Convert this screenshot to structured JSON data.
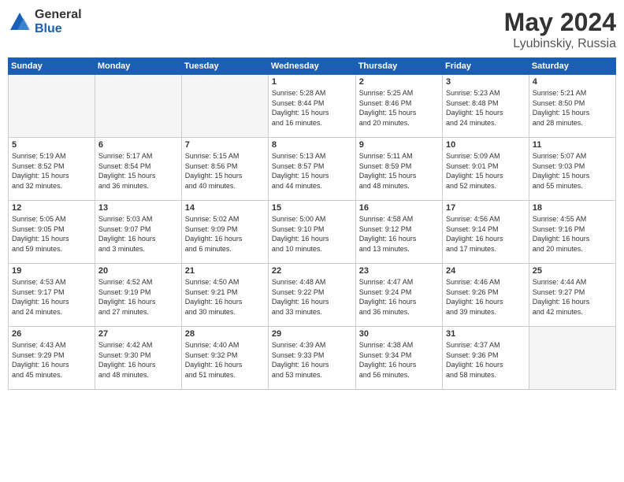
{
  "logo": {
    "general": "General",
    "blue": "Blue"
  },
  "title": {
    "month_year": "May 2024",
    "location": "Lyubinskiy, Russia"
  },
  "weekdays": [
    "Sunday",
    "Monday",
    "Tuesday",
    "Wednesday",
    "Thursday",
    "Friday",
    "Saturday"
  ],
  "weeks": [
    [
      {
        "day": "",
        "info": ""
      },
      {
        "day": "",
        "info": ""
      },
      {
        "day": "",
        "info": ""
      },
      {
        "day": "1",
        "info": "Sunrise: 5:28 AM\nSunset: 8:44 PM\nDaylight: 15 hours\nand 16 minutes."
      },
      {
        "day": "2",
        "info": "Sunrise: 5:25 AM\nSunset: 8:46 PM\nDaylight: 15 hours\nand 20 minutes."
      },
      {
        "day": "3",
        "info": "Sunrise: 5:23 AM\nSunset: 8:48 PM\nDaylight: 15 hours\nand 24 minutes."
      },
      {
        "day": "4",
        "info": "Sunrise: 5:21 AM\nSunset: 8:50 PM\nDaylight: 15 hours\nand 28 minutes."
      }
    ],
    [
      {
        "day": "5",
        "info": "Sunrise: 5:19 AM\nSunset: 8:52 PM\nDaylight: 15 hours\nand 32 minutes."
      },
      {
        "day": "6",
        "info": "Sunrise: 5:17 AM\nSunset: 8:54 PM\nDaylight: 15 hours\nand 36 minutes."
      },
      {
        "day": "7",
        "info": "Sunrise: 5:15 AM\nSunset: 8:56 PM\nDaylight: 15 hours\nand 40 minutes."
      },
      {
        "day": "8",
        "info": "Sunrise: 5:13 AM\nSunset: 8:57 PM\nDaylight: 15 hours\nand 44 minutes."
      },
      {
        "day": "9",
        "info": "Sunrise: 5:11 AM\nSunset: 8:59 PM\nDaylight: 15 hours\nand 48 minutes."
      },
      {
        "day": "10",
        "info": "Sunrise: 5:09 AM\nSunset: 9:01 PM\nDaylight: 15 hours\nand 52 minutes."
      },
      {
        "day": "11",
        "info": "Sunrise: 5:07 AM\nSunset: 9:03 PM\nDaylight: 15 hours\nand 55 minutes."
      }
    ],
    [
      {
        "day": "12",
        "info": "Sunrise: 5:05 AM\nSunset: 9:05 PM\nDaylight: 15 hours\nand 59 minutes."
      },
      {
        "day": "13",
        "info": "Sunrise: 5:03 AM\nSunset: 9:07 PM\nDaylight: 16 hours\nand 3 minutes."
      },
      {
        "day": "14",
        "info": "Sunrise: 5:02 AM\nSunset: 9:09 PM\nDaylight: 16 hours\nand 6 minutes."
      },
      {
        "day": "15",
        "info": "Sunrise: 5:00 AM\nSunset: 9:10 PM\nDaylight: 16 hours\nand 10 minutes."
      },
      {
        "day": "16",
        "info": "Sunrise: 4:58 AM\nSunset: 9:12 PM\nDaylight: 16 hours\nand 13 minutes."
      },
      {
        "day": "17",
        "info": "Sunrise: 4:56 AM\nSunset: 9:14 PM\nDaylight: 16 hours\nand 17 minutes."
      },
      {
        "day": "18",
        "info": "Sunrise: 4:55 AM\nSunset: 9:16 PM\nDaylight: 16 hours\nand 20 minutes."
      }
    ],
    [
      {
        "day": "19",
        "info": "Sunrise: 4:53 AM\nSunset: 9:17 PM\nDaylight: 16 hours\nand 24 minutes."
      },
      {
        "day": "20",
        "info": "Sunrise: 4:52 AM\nSunset: 9:19 PM\nDaylight: 16 hours\nand 27 minutes."
      },
      {
        "day": "21",
        "info": "Sunrise: 4:50 AM\nSunset: 9:21 PM\nDaylight: 16 hours\nand 30 minutes."
      },
      {
        "day": "22",
        "info": "Sunrise: 4:48 AM\nSunset: 9:22 PM\nDaylight: 16 hours\nand 33 minutes."
      },
      {
        "day": "23",
        "info": "Sunrise: 4:47 AM\nSunset: 9:24 PM\nDaylight: 16 hours\nand 36 minutes."
      },
      {
        "day": "24",
        "info": "Sunrise: 4:46 AM\nSunset: 9:26 PM\nDaylight: 16 hours\nand 39 minutes."
      },
      {
        "day": "25",
        "info": "Sunrise: 4:44 AM\nSunset: 9:27 PM\nDaylight: 16 hours\nand 42 minutes."
      }
    ],
    [
      {
        "day": "26",
        "info": "Sunrise: 4:43 AM\nSunset: 9:29 PM\nDaylight: 16 hours\nand 45 minutes."
      },
      {
        "day": "27",
        "info": "Sunrise: 4:42 AM\nSunset: 9:30 PM\nDaylight: 16 hours\nand 48 minutes."
      },
      {
        "day": "28",
        "info": "Sunrise: 4:40 AM\nSunset: 9:32 PM\nDaylight: 16 hours\nand 51 minutes."
      },
      {
        "day": "29",
        "info": "Sunrise: 4:39 AM\nSunset: 9:33 PM\nDaylight: 16 hours\nand 53 minutes."
      },
      {
        "day": "30",
        "info": "Sunrise: 4:38 AM\nSunset: 9:34 PM\nDaylight: 16 hours\nand 56 minutes."
      },
      {
        "day": "31",
        "info": "Sunrise: 4:37 AM\nSunset: 9:36 PM\nDaylight: 16 hours\nand 58 minutes."
      },
      {
        "day": "",
        "info": ""
      }
    ]
  ]
}
